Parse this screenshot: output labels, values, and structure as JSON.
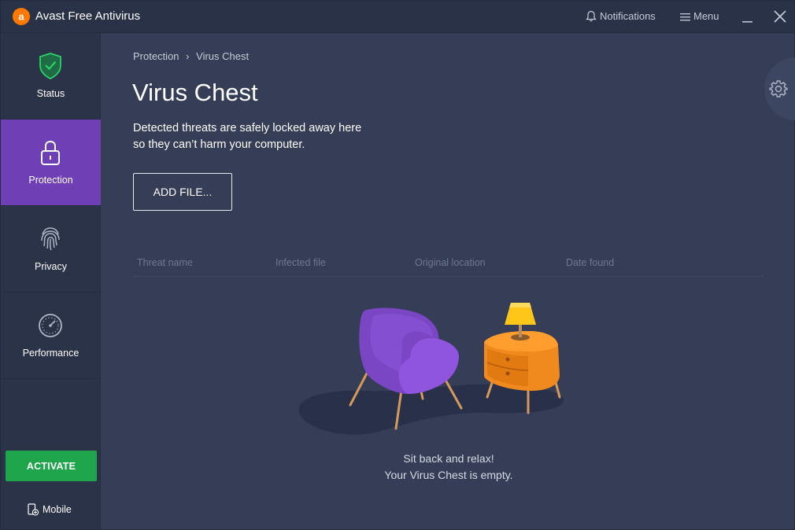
{
  "app": {
    "title": "Avast Free Antivirus"
  },
  "titlebar": {
    "notifications_label": "Notifications",
    "menu_label": "Menu"
  },
  "sidebar": {
    "items": [
      {
        "label": "Status",
        "icon": "shield-check-icon"
      },
      {
        "label": "Protection",
        "icon": "lock-icon",
        "active": true
      },
      {
        "label": "Privacy",
        "icon": "fingerprint-icon"
      },
      {
        "label": "Performance",
        "icon": "speedometer-icon"
      }
    ],
    "activate_label": "ACTIVATE",
    "mobile_label": "Mobile"
  },
  "main": {
    "breadcrumb": {
      "parent": "Protection",
      "separator": "›",
      "current": "Virus Chest"
    },
    "title": "Virus Chest",
    "description_line1": "Detected threats are safely locked away here",
    "description_line2": "so they can’t harm your computer.",
    "add_file_label": "ADD FILE...",
    "table_columns": [
      "Threat name",
      "Infected file",
      "Original location",
      "Date found"
    ],
    "empty_line1": "Sit back and relax!",
    "empty_line2": "Your Virus Chest is empty."
  },
  "colors": {
    "background": "#353e56",
    "sidebar": "#2b3348",
    "active_nav": "#6f3fb6",
    "activate_green": "#1fa64c",
    "brand_orange": "#ff7800"
  }
}
